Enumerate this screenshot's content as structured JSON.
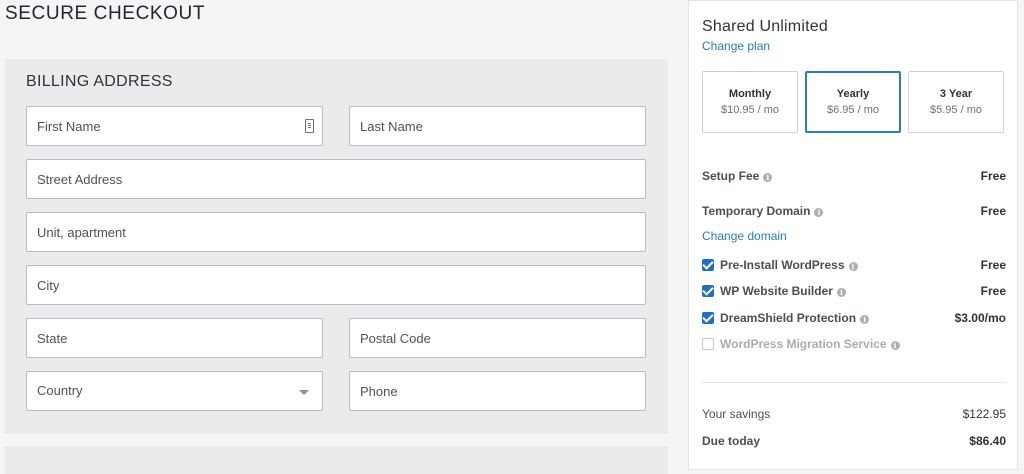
{
  "page": {
    "title": "SECURE CHECKOUT"
  },
  "billing": {
    "heading": "BILLING ADDRESS",
    "fields": {
      "first_name": "First Name",
      "last_name": "Last Name",
      "street": "Street Address",
      "unit": "Unit, apartment",
      "city": "City",
      "state": "State",
      "postal": "Postal Code",
      "country": "Country",
      "phone": "Phone"
    }
  },
  "summary": {
    "plan_name": "Shared Unlimited",
    "change_plan": "Change plan",
    "terms": [
      {
        "name": "Monthly",
        "price": "$10.95 / mo",
        "selected": false
      },
      {
        "name": "Yearly",
        "price": "$6.95 / mo",
        "selected": true
      },
      {
        "name": "3 Year",
        "price": "$5.95 / mo",
        "selected": false
      }
    ],
    "setup_fee": {
      "label": "Setup Fee",
      "value": "Free"
    },
    "temp_domain": {
      "label": "Temporary Domain",
      "value": "Free"
    },
    "change_domain": "Change domain",
    "addons": [
      {
        "label": "Pre-Install WordPress",
        "value": "Free",
        "checked": true
      },
      {
        "label": "WP Website Builder",
        "value": "Free",
        "checked": true
      },
      {
        "label": "DreamShield Protection",
        "value": "$3.00/mo",
        "checked": true
      },
      {
        "label": "WordPress Migration Service",
        "value": "",
        "checked": false
      }
    ],
    "savings": {
      "label": "Your savings",
      "value": "$122.95"
    },
    "due_today": {
      "label": "Due today",
      "value": "$86.40"
    }
  },
  "icons": {
    "info": "info-icon",
    "select": "chevron-down-icon",
    "autofill": "contact-card-icon"
  },
  "colors": {
    "accent": "#2a7bc0",
    "checkbox": "#1e70c4"
  }
}
